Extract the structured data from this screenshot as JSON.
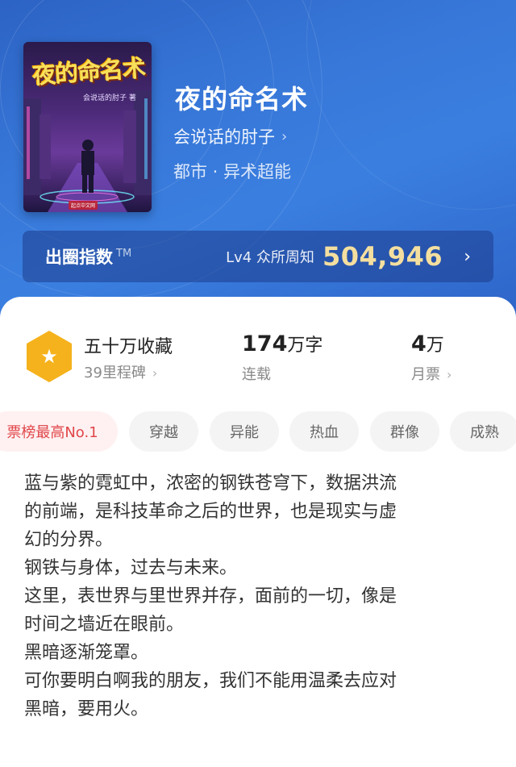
{
  "book": {
    "title": "夜的命名术",
    "author": "会说话的肘子",
    "genre": "都市 · 异术超能",
    "cover": {
      "title_art": "夜的命名术",
      "author_art": "会说话的肘子 著",
      "publisher_art": "起点中文网"
    }
  },
  "fame": {
    "label": "出圈指数",
    "tm": "TM",
    "level": "Lv4 众所周知",
    "value": "504,946"
  },
  "stats": {
    "collect_main": "五十万收藏",
    "collect_sub": "39里程碑",
    "words_num": "174",
    "words_unit": "万字",
    "words_sub": "连载",
    "votes_num": "4",
    "votes_unit": "万",
    "votes_sub": "月票"
  },
  "tags": [
    "票榜最高No.1",
    "穿越",
    "异能",
    "热血",
    "群像",
    "成熟"
  ],
  "synopsis": [
    "蓝与紫的霓虹中，浓密的钢铁苍穹下，数据洪流",
    "的前端，是科技革命之后的世界，也是现实与虚",
    "幻的分界。",
    "钢铁与身体，过去与未来。",
    "这里，表世界与里世界并存，面前的一切，像是",
    "时间之墙近在眼前。",
    "黑暗逐渐笼罩。",
    "可你要明白啊我的朋友，我们不能用温柔去应对",
    "黑暗，要用火。"
  ],
  "colors": {
    "hero_bg": "#3777d8",
    "fame_value": "#f4df9f",
    "badge": "#f5b21c",
    "hot_tag": "#e0464a"
  },
  "icons": {
    "chevron": "chevron-right-icon",
    "badge": "star-badge-icon"
  }
}
